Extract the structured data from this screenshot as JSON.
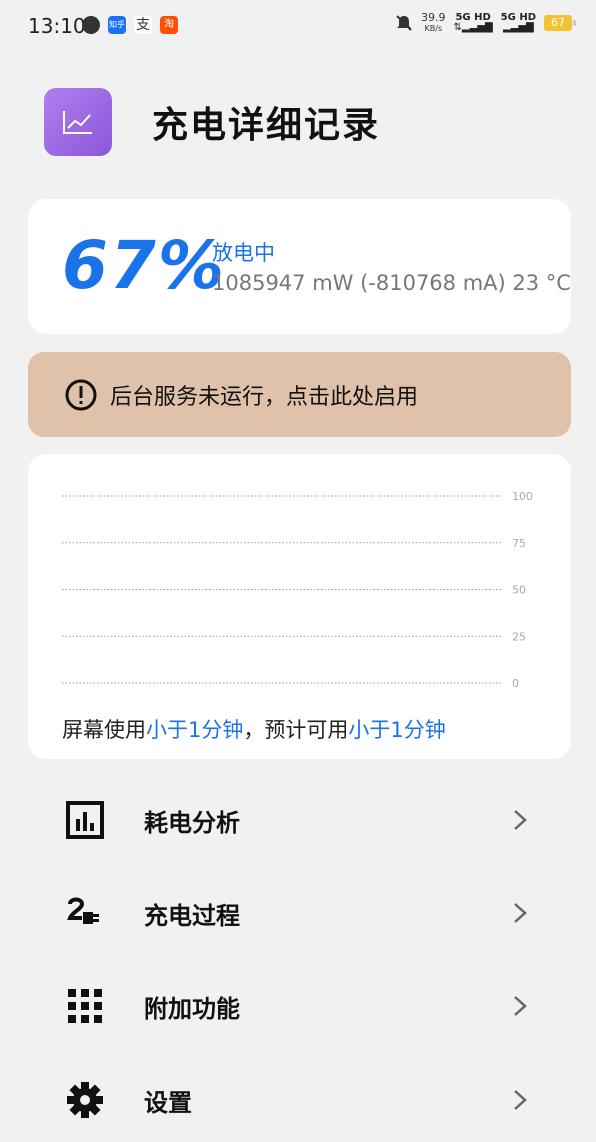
{
  "status_bar": {
    "time": "13:10",
    "apps": [
      {
        "icon": "wechat-icon",
        "color": "#333333",
        "glyph": "●"
      },
      {
        "icon": "zhihu-icon",
        "color": "#1772f6",
        "glyph": "知乎"
      },
      {
        "icon": "alipay-icon",
        "color": "#333333",
        "glyph": "支"
      },
      {
        "icon": "taobao-icon",
        "color": "#ff5000",
        "glyph": "淘"
      }
    ],
    "net_speed": "39.9",
    "net_unit": "KB/s",
    "sim1": "5G HD",
    "sim2": "5G HD",
    "battery": "67"
  },
  "header": {
    "title": "充电详细记录"
  },
  "battery_card": {
    "percent": "67%",
    "state": "放电中",
    "detail": "1085947 mW (-810768 mA) 23 °C"
  },
  "warning": {
    "text": "后台服务未运行，点击此处启用"
  },
  "chart_data": {
    "type": "line",
    "y_ticks": [
      "100",
      "75",
      "50",
      "25",
      "0"
    ],
    "ylim": [
      0,
      100
    ],
    "series": []
  },
  "usage": {
    "prefix": "屏幕使用",
    "screen_time": "小于1分钟",
    "middle": "，预计可用",
    "estimate": "小于1分钟"
  },
  "menu": [
    {
      "label": "耗电分析",
      "icon": "bar-chart-icon"
    },
    {
      "label": "充电过程",
      "icon": "plug-icon"
    },
    {
      "label": "附加功能",
      "icon": "grid-icon"
    },
    {
      "label": "设置",
      "icon": "gear-icon"
    }
  ],
  "colors": {
    "accent": "#1a73e8",
    "warning_bg": "#dfc2a9",
    "app_icon": "#9b6ae3"
  }
}
